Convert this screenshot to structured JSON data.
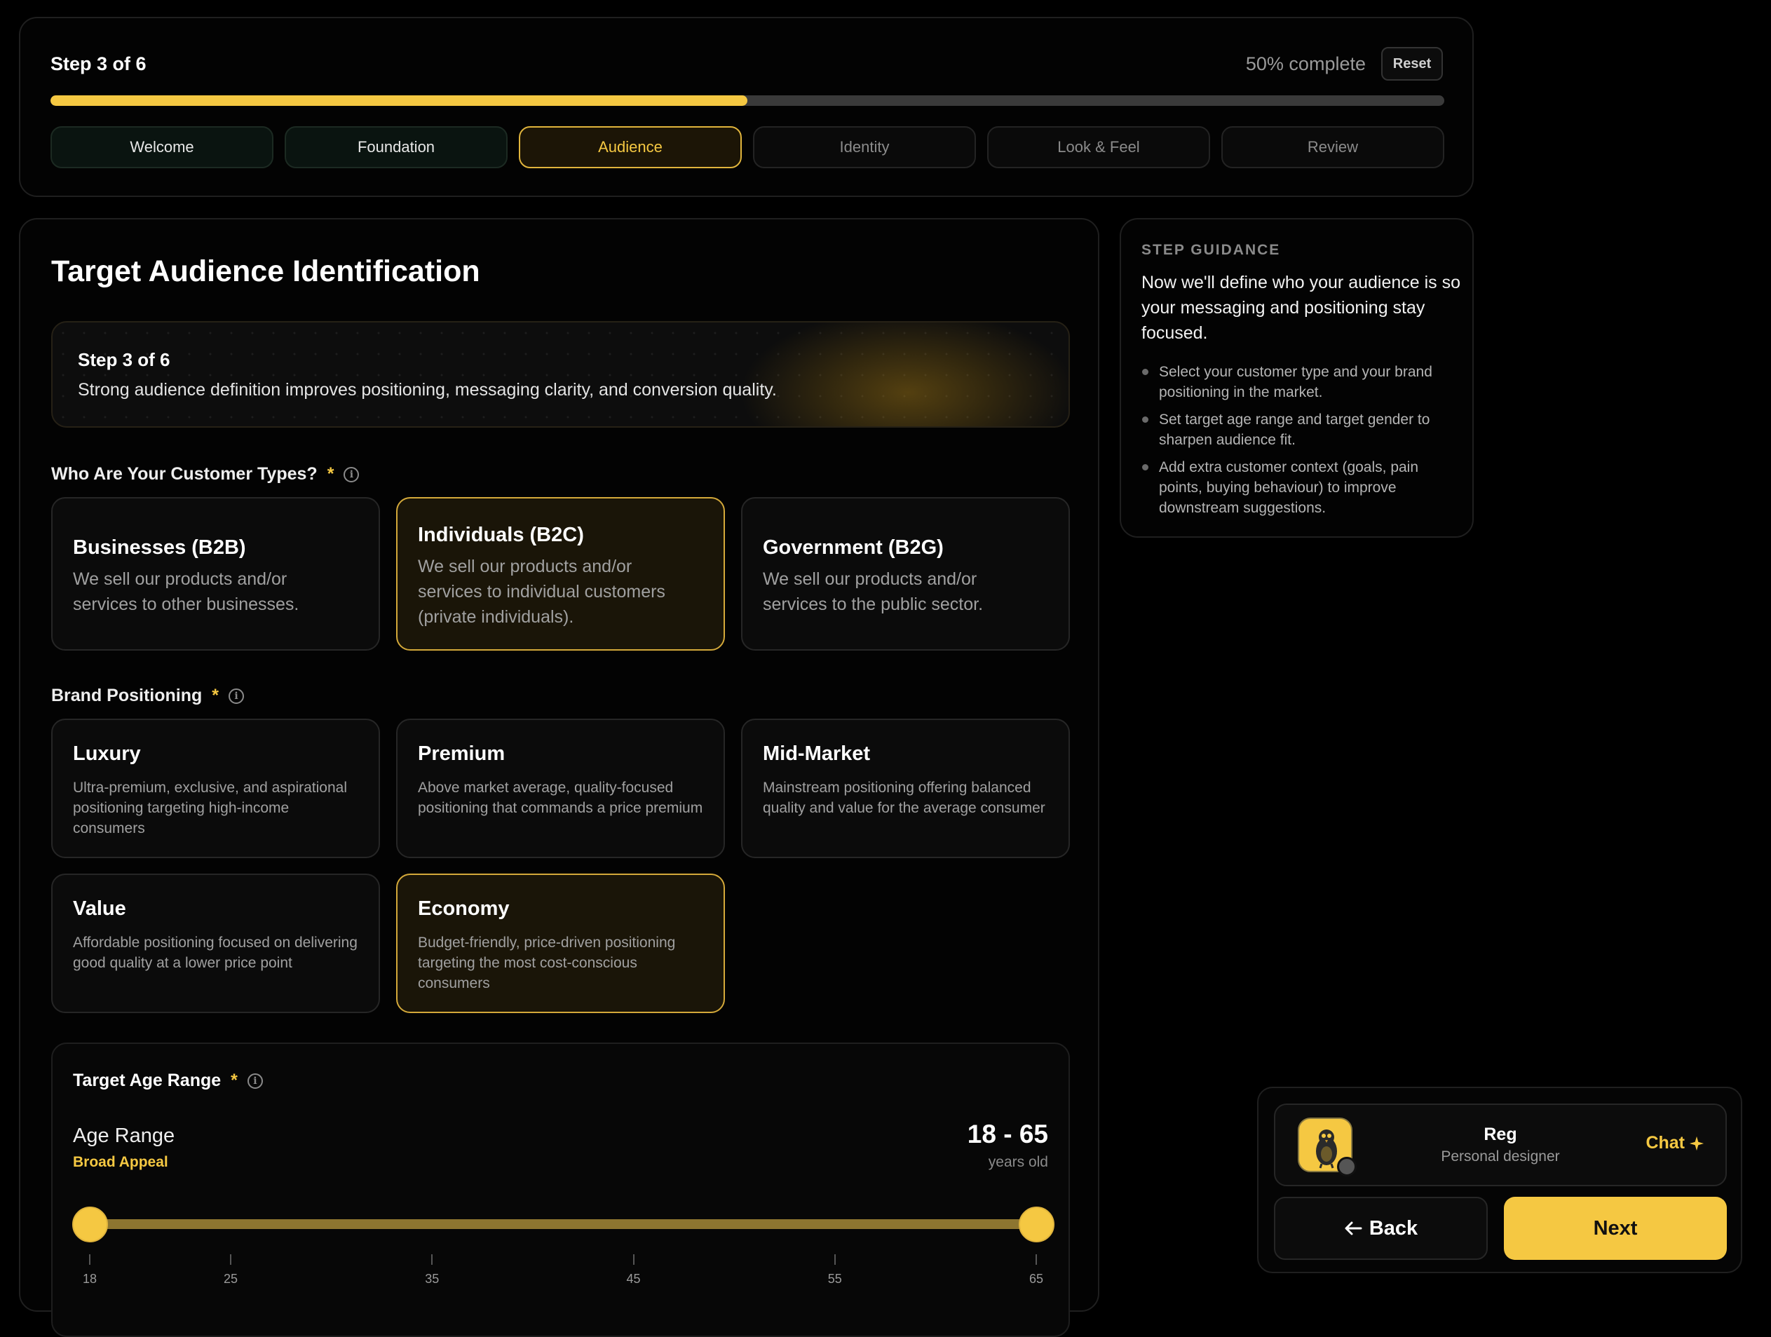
{
  "progress": {
    "step_label": "Step 3 of 6",
    "percent_label": "50% complete",
    "percent_value": 50,
    "reset_label": "Reset",
    "steps": [
      {
        "label": "Welcome",
        "state": "done"
      },
      {
        "label": "Foundation",
        "state": "done"
      },
      {
        "label": "Audience",
        "state": "active"
      },
      {
        "label": "Identity",
        "state": "pending"
      },
      {
        "label": "Look & Feel",
        "state": "pending"
      },
      {
        "label": "Review",
        "state": "pending"
      }
    ]
  },
  "main": {
    "title": "Target Audience Identification",
    "banner": {
      "title": "Step 3 of 6",
      "text": "Strong audience definition improves positioning, messaging clarity, and conversion quality."
    },
    "customer_types": {
      "label": "Who Are Your Customer Types?",
      "required": "*",
      "options": [
        {
          "title": "Businesses (B2B)",
          "desc": "We sell our products and/or services to other businesses.",
          "selected": false
        },
        {
          "title": "Individuals (B2C)",
          "desc": "We sell our products and/or services to individual customers (private individuals).",
          "selected": true
        },
        {
          "title": "Government (B2G)",
          "desc": "We sell our products and/or services to the public sector.",
          "selected": false
        }
      ]
    },
    "brand_positioning": {
      "label": "Brand Positioning",
      "required": "*",
      "options": [
        {
          "title": "Luxury",
          "desc": "Ultra-premium, exclusive, and aspirational positioning targeting high-income consumers",
          "selected": false
        },
        {
          "title": "Premium",
          "desc": "Above market average, quality-focused positioning that commands a price premium",
          "selected": false
        },
        {
          "title": "Mid-Market",
          "desc": "Mainstream positioning offering balanced quality and value for the average consumer",
          "selected": false
        },
        {
          "title": "Value",
          "desc": "Affordable positioning focused on delivering good quality at a lower price point",
          "selected": false
        },
        {
          "title": "Economy",
          "desc": "Budget-friendly, price-driven positioning targeting the most cost-conscious consumers",
          "selected": true
        }
      ]
    },
    "age_range": {
      "label": "Target Age Range",
      "required": "*",
      "sub_label": "Age Range",
      "appeal": "Broad Appeal",
      "value_label": "18 - 65",
      "unit": "years old",
      "min": 18,
      "max": 65,
      "low": 18,
      "high": 65,
      "ticks": [
        "18",
        "25",
        "35",
        "45",
        "55",
        "65"
      ]
    }
  },
  "guidance": {
    "heading": "STEP GUIDANCE",
    "intro": "Now we'll define who your audience is so your messaging and positioning stay focused.",
    "items": [
      "Select your customer type and your brand positioning in the market.",
      "Set target age range and target gender to sharpen audience fit.",
      "Add extra customer context (goals, pain points, buying behaviour) to improve downstream suggestions."
    ]
  },
  "assistant": {
    "name": "Reg",
    "role": "Personal designer",
    "chat_label": "Chat",
    "back_label": "Back",
    "next_label": "Next"
  },
  "icons": {
    "info": "info-icon",
    "sparkle": "sparkle-icon",
    "back": "arrow-left-icon"
  },
  "colors": {
    "accent": "#f5c842",
    "background": "#000000"
  }
}
